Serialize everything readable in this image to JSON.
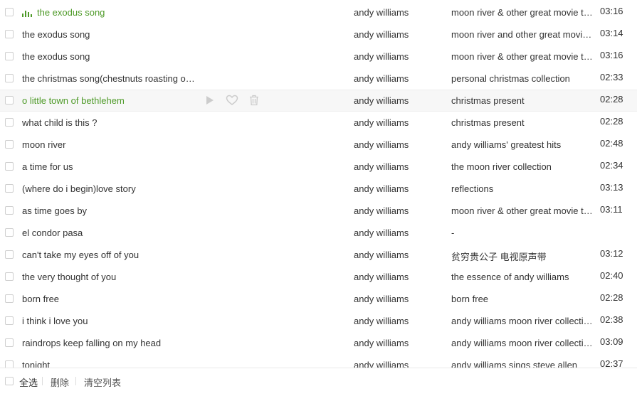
{
  "songs": [
    {
      "title": "the exodus song",
      "artist": "andy williams",
      "album": "moon river & other great movie themes",
      "duration": "03:16",
      "state": "playing"
    },
    {
      "title": "the exodus song",
      "artist": "andy williams",
      "album": "moon river and other great movie themes",
      "duration": "03:14"
    },
    {
      "title": "the exodus song",
      "artist": "andy williams",
      "album": "moon river & other great movie themes",
      "duration": "03:16"
    },
    {
      "title": "the christmas song(chestnuts roasting on an open fire)",
      "artist": "andy williams",
      "album": "personal christmas collection",
      "duration": "02:33"
    },
    {
      "title": "o little town of bethlehem",
      "artist": "andy williams",
      "album": "christmas present",
      "duration": "02:28",
      "state": "hover"
    },
    {
      "title": "what child is this ?",
      "artist": "andy williams",
      "album": "christmas present",
      "duration": "02:28"
    },
    {
      "title": "moon river",
      "artist": "andy williams",
      "album": "andy williams' greatest hits",
      "duration": "02:48"
    },
    {
      "title": "a time for us",
      "artist": "andy williams",
      "album": "the moon river collection",
      "duration": "02:34"
    },
    {
      "title": "(where do i begin)love story",
      "artist": "andy williams",
      "album": "reflections",
      "duration": "03:13"
    },
    {
      "title": "as time goes by",
      "artist": "andy williams",
      "album": "moon river & other great movie themes",
      "duration": "03:11"
    },
    {
      "title": "el condor pasa",
      "artist": "andy williams",
      "album": "-",
      "duration": ""
    },
    {
      "title": "can't take my eyes off of you",
      "artist": "andy williams",
      "album": "贫穷贵公子 电视原声带",
      "duration": "03:12"
    },
    {
      "title": "the very thought of you",
      "artist": "andy williams",
      "album": "the essence of andy williams",
      "duration": "02:40"
    },
    {
      "title": "born free",
      "artist": "andy williams",
      "album": "born free",
      "duration": "02:28"
    },
    {
      "title": "i think i love you",
      "artist": "andy williams",
      "album": "andy williams moon river collection",
      "duration": "02:38"
    },
    {
      "title": "raindrops keep falling on my head",
      "artist": "andy williams",
      "album": "andy williams moon river collection",
      "duration": "03:09"
    },
    {
      "title": "tonight",
      "artist": "andy williams",
      "album": "andy williams sings steve allen",
      "duration": "02:37"
    }
  ],
  "row_actions": {
    "play_icon": "play-icon",
    "like_icon": "heart-icon",
    "delete_icon": "trash-icon"
  },
  "footer": {
    "select_all": "全选",
    "delete": "删除",
    "clear_list": "清空列表"
  },
  "colors": {
    "accent": "#4e9a28",
    "icon_muted": "#cccccc"
  }
}
